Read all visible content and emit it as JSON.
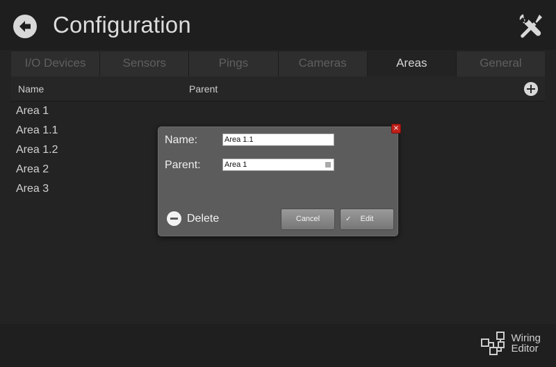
{
  "header": {
    "title": "Configuration",
    "back_icon": "back-arrow-icon",
    "tools_icon": "tools-icon"
  },
  "tabs": [
    {
      "label": "I/O Devices",
      "active": false
    },
    {
      "label": "Sensors",
      "active": false
    },
    {
      "label": "Pings",
      "active": false
    },
    {
      "label": "Cameras",
      "active": false
    },
    {
      "label": "Areas",
      "active": true
    },
    {
      "label": "General",
      "active": false
    }
  ],
  "table": {
    "columns": [
      "Name",
      "Parent"
    ],
    "rows": [
      {
        "name": "Area 1"
      },
      {
        "name": "Area 1.1"
      },
      {
        "name": "Area 1.2"
      },
      {
        "name": "Area 2"
      },
      {
        "name": "Area 3"
      }
    ]
  },
  "dialog": {
    "name_label": "Name:",
    "name_value": "Area 1.1",
    "parent_label": "Parent:",
    "parent_value": "Area 1",
    "close_glyph": "×",
    "delete_label": "Delete",
    "cancel_label": "Cancel",
    "edit_check": "✓",
    "edit_label": "Edit"
  },
  "footer": {
    "wiring_line1": "Wiring",
    "wiring_line2": "Editor"
  },
  "colors": {
    "background": "#232323",
    "dialog": "#5c5c5c",
    "close": "#c0201a"
  }
}
